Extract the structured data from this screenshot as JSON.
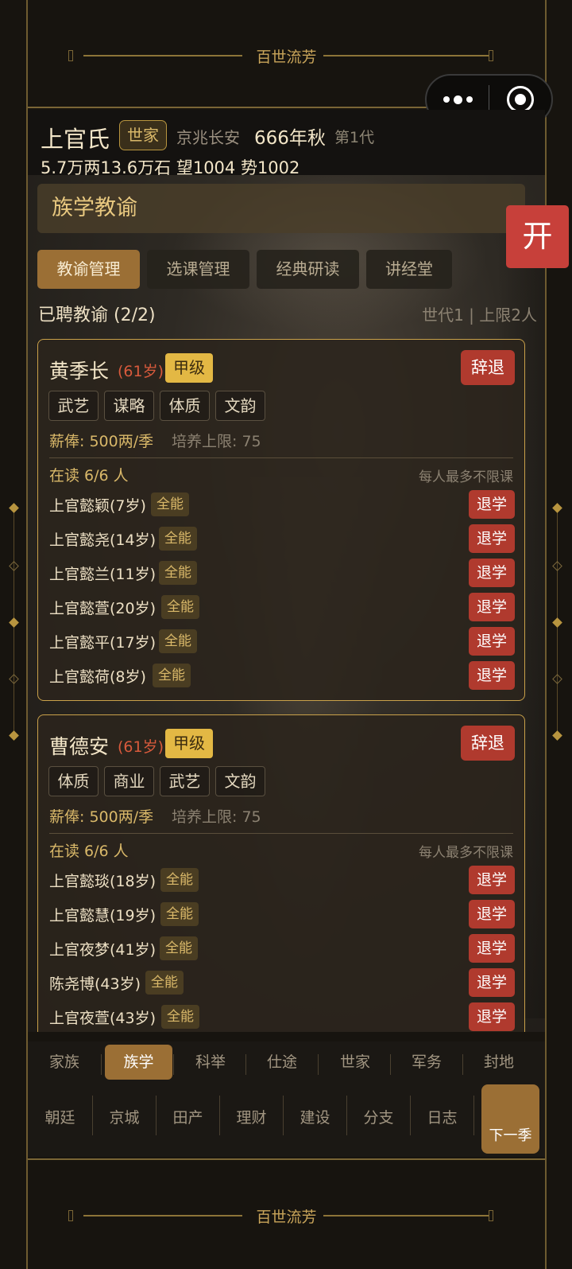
{
  "top_banner": {
    "title": "百世流芳"
  },
  "bottom_banner": {
    "title": "百世流芳"
  },
  "header": {
    "clan_name": "上官氏",
    "clan_tag": "世家",
    "region": "京兆长安",
    "year": "666年秋",
    "generation": "第1代",
    "stats": "5.7万两13.6万石  望1004 势1002"
  },
  "section": {
    "title": "族学教谕",
    "tabs": [
      "教谕管理",
      "选课管理",
      "经典研读",
      "讲经堂"
    ],
    "active_tab": 0,
    "hired_label": "已聘教谕 (2/2)",
    "limit_label": "世代1 | 上限2人"
  },
  "teachers": [
    {
      "name": "黄季长",
      "age": "(61岁)",
      "grade": "甲级",
      "dismiss_label": "辞退",
      "skills": [
        "武艺",
        "谋略",
        "体质",
        "文韵"
      ],
      "salary": "薪俸: 500两/季",
      "cap": "培养上限: 75",
      "enrolled": "在读 6/6 人",
      "note": "每人最多不限课",
      "students": [
        {
          "name": "上官懿颖(7岁)",
          "badge": "全能",
          "action": "退学"
        },
        {
          "name": "上官懿尧(14岁)",
          "badge": "全能",
          "action": "退学"
        },
        {
          "name": "上官懿兰(11岁)",
          "badge": "全能",
          "action": "退学"
        },
        {
          "name": "上官懿萱(20岁)",
          "badge": "全能",
          "action": "退学"
        },
        {
          "name": "上官懿平(17岁)",
          "badge": "全能",
          "action": "退学"
        },
        {
          "name": "上官懿荷(8岁)",
          "badge": "全能",
          "action": "退学"
        }
      ]
    },
    {
      "name": "曹德安",
      "age": "(61岁)",
      "grade": "甲级",
      "dismiss_label": "辞退",
      "skills": [
        "体质",
        "商业",
        "武艺",
        "文韵"
      ],
      "salary": "薪俸: 500两/季",
      "cap": "培养上限: 75",
      "enrolled": "在读 6/6 人",
      "note": "每人最多不限课",
      "students": [
        {
          "name": "上官懿琰(18岁)",
          "badge": "全能",
          "action": "退学"
        },
        {
          "name": "上官懿慧(19岁)",
          "badge": "全能",
          "action": "退学"
        },
        {
          "name": "上官夜梦(41岁)",
          "badge": "全能",
          "action": "退学"
        },
        {
          "name": "陈尧博(43岁)",
          "badge": "全能",
          "action": "退学"
        },
        {
          "name": "上官夜萱(43岁)",
          "badge": "全能",
          "action": "退学"
        }
      ]
    }
  ],
  "nav": {
    "row1": [
      "家族",
      "族学",
      "科举",
      "仕途",
      "世家",
      "军务",
      "封地"
    ],
    "row1_active": 1,
    "row2": [
      "朝廷",
      "京城",
      "田产",
      "理财",
      "建设",
      "分支",
      "日志"
    ],
    "next_label": "下一季"
  },
  "open_button": "开",
  "colors": {
    "accent_gold": "#c9a14a",
    "active_tab": "#9b6f35",
    "danger_red": "#b03a2e",
    "grade_yellow": "#e3b844",
    "age_red": "#d85a3c"
  }
}
